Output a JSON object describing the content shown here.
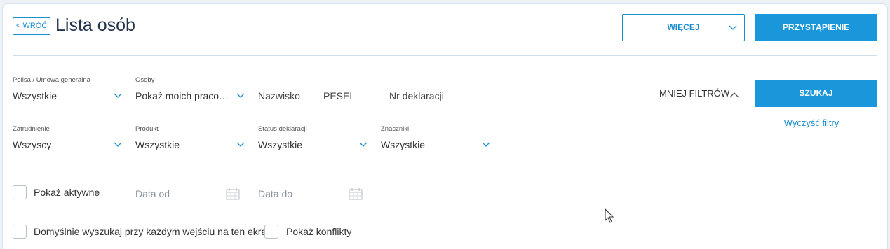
{
  "header": {
    "back_label": "< WRÓĆ",
    "title": "Lista osób",
    "more_label": "WIĘCEJ",
    "join_label": "PRZYSTĄPIENIE"
  },
  "filters": {
    "polisa": {
      "label": "Polisa / Umowa generalna",
      "value": "Wszystkie"
    },
    "osoby": {
      "label": "Osoby",
      "value": "Pokaż moich praco…"
    },
    "nazwisko": {
      "placeholder": "Nazwisko"
    },
    "pesel": {
      "placeholder": "PESEL"
    },
    "nr_deklaracji": {
      "placeholder": "Nr deklaracji"
    },
    "zatrudnienie": {
      "label": "Zatrudnienie",
      "value": "Wszyscy"
    },
    "produkt": {
      "label": "Produkt",
      "value": "Wszystkie"
    },
    "status_deklaracji": {
      "label": "Status deklaracji",
      "value": "Wszystkie"
    },
    "znaczniki": {
      "label": "Znaczniki",
      "value": "Wszystkie"
    },
    "data_od": {
      "placeholder": "Data od"
    },
    "data_do": {
      "placeholder": "Data do"
    }
  },
  "actions": {
    "fewer_filters": "MNIEJ FILTRÓW",
    "search": "SZUKAJ",
    "clear": "Wyczyść filtry"
  },
  "checkboxes": {
    "active": {
      "label": "Pokaż aktywne",
      "checked": false
    },
    "default_search": {
      "label": "Domyślnie wyszukaj przy każdym wejściu na ten ekran",
      "checked": false
    },
    "conflicts": {
      "label": "Pokaż konflikty",
      "checked": false
    }
  },
  "colors": {
    "accent": "#1a97da",
    "link": "#1a8fd0",
    "title": "#22344d"
  }
}
